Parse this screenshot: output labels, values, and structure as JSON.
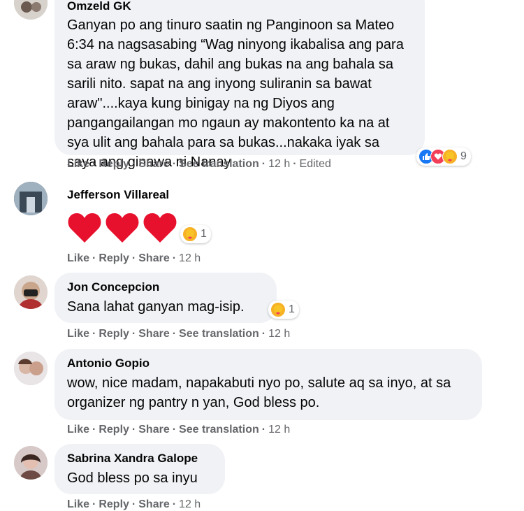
{
  "actions": {
    "like": "Like",
    "reply": "Reply",
    "share": "Share",
    "translate": "See translation"
  },
  "comments": [
    {
      "author": "Omzeld GK",
      "text": "Ganyan po ang tinuro saatin ng Panginoon sa Mateo 6:34 na nagsasabing “Wag ninyong ikabalisa ang para sa araw ng bukas, dahil ang bukas na ang bahala sa sarili nito. sapat na ang inyong suliranin sa bawat araw\"....kaya kung binigay na ng Diyos ang pangangailangan mo ngaun ay makontento ka na at sya ulit ang bahala para sa bukas...nakaka iyak sa saya ang ginawa ni Nanay",
      "time": "12 h",
      "edited": "Edited",
      "reaction_count": "9",
      "reactions": [
        "like-icon",
        "love-icon",
        "care-icon"
      ]
    },
    {
      "author": "Jefferson Villareal",
      "text": "❤❤❤",
      "time": "12 h",
      "reaction_count": "1",
      "reactions": [
        "care-icon"
      ]
    },
    {
      "author": "Jon Concepcion",
      "text": "Sana lahat ganyan mag-isip.",
      "time": "12 h",
      "reaction_count": "1",
      "reactions": [
        "care-icon"
      ]
    },
    {
      "author": "Antonio Gopio",
      "text": "wow, nice madam, napakabuti nyo po, salute aq sa inyo, at sa organizer ng pantry n yan, God bless po.",
      "time": "12 h"
    },
    {
      "author": "Sabrina Xandra Galope",
      "text": "God bless po sa inyu",
      "time": "12 h"
    }
  ],
  "colors": {
    "bubble": "#f0f2f5",
    "meta": "#65676b",
    "like": "#1877f2",
    "love": "#f33e58",
    "care": "#f7b125"
  }
}
